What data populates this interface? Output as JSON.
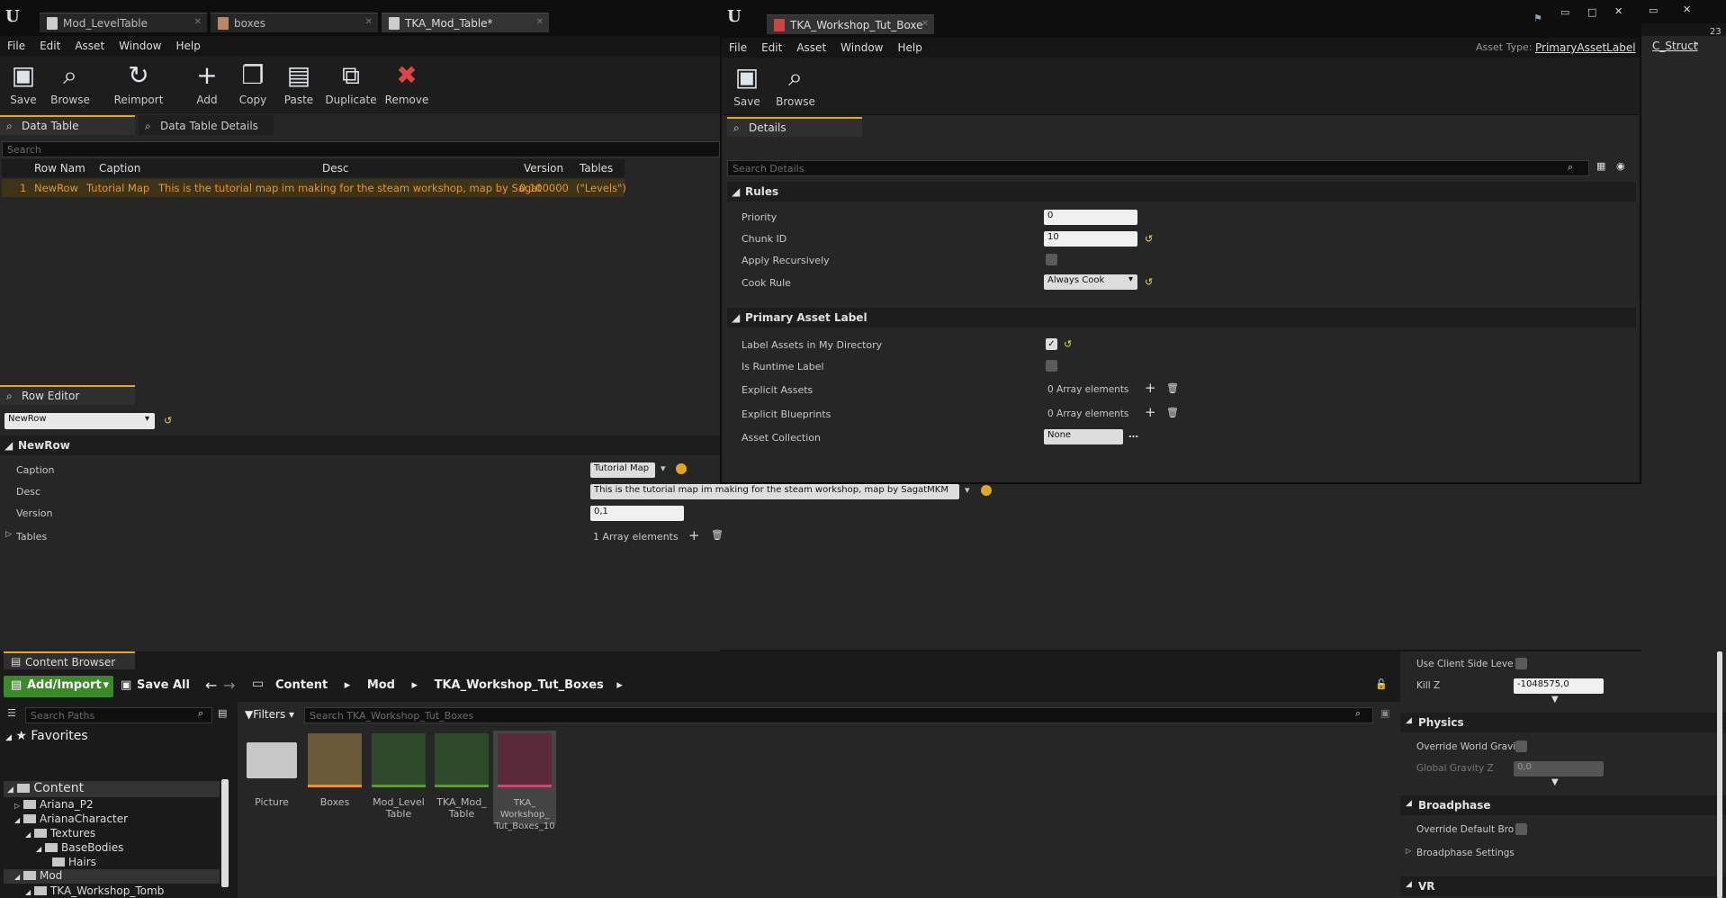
{
  "left_window": {
    "tabs": [
      {
        "label": "Mod_LevelTable"
      },
      {
        "label": "boxes"
      },
      {
        "label": "TKA_Mod_Table*"
      }
    ],
    "menu": [
      "File",
      "Edit",
      "Asset",
      "Window",
      "Help"
    ],
    "toolbar": [
      "Save",
      "Browse",
      "Reimport",
      "Add",
      "Copy",
      "Paste",
      "Duplicate",
      "Remove"
    ],
    "panel_tabs": {
      "data_table": "Data Table",
      "details": "Data Table Details"
    },
    "search_placeholder": "Search",
    "table": {
      "headers": [
        "Row Nam",
        "Caption",
        "Desc",
        "Version",
        "Tables"
      ],
      "rows": [
        [
          "1",
          "NewRow",
          "Tutorial Map",
          "This is the tutorial map im making for the steam workshop, map by Sagat",
          "0.100000",
          "(\"Levels\")"
        ]
      ]
    },
    "row_editor": {
      "tab": "Row Editor",
      "row_select": "NewRow",
      "section": "NewRow",
      "fields": {
        "caption_label": "Caption",
        "caption_value": "Tutorial Map",
        "desc_label": "Desc",
        "desc_value": "This is the tutorial map im making for the steam workshop, map by SagatMKM",
        "version_label": "Version",
        "version_value": "0,1",
        "tables_label": "Tables",
        "tables_value": "1 Array elements"
      }
    }
  },
  "right_window": {
    "tab": "TKA_Workshop_Tut_Boxe",
    "menu": [
      "File",
      "Edit",
      "Asset",
      "Window",
      "Help"
    ],
    "asset_type_label": "Asset Type:",
    "asset_type_value": "PrimaryAssetLabel",
    "toolbar": [
      "Save",
      "Browse"
    ],
    "details_tab": "Details",
    "search_placeholder": "Search Details",
    "rules": {
      "title": "Rules",
      "priority_label": "Priority",
      "priority_value": "0",
      "chunk_label": "Chunk ID",
      "chunk_value": "10",
      "apply_label": "Apply Recursively",
      "cook_label": "Cook Rule",
      "cook_value": "Always Cook"
    },
    "label_section": {
      "title": "Primary Asset Label",
      "label_assets": "Label Assets in My Directory",
      "runtime": "Is Runtime Label",
      "explicit_assets": "Explicit Assets",
      "explicit_assets_value": "0 Array elements",
      "explicit_bp": "Explicit Blueprints",
      "explicit_bp_value": "0 Array elements",
      "collection": "Asset Collection",
      "collection_value": "None"
    }
  },
  "partial_right": {
    "struct_text": "C_Struct",
    "num_text": "23",
    "use_client": "Use Client Side Leve",
    "killz_label": "Kill Z",
    "killz_value": "-1048575,0",
    "physics": "Physics",
    "override_gravity": "Override World Gravi",
    "global_gravity": "Global Gravity Z",
    "global_gravity_value": "0,0",
    "broadphase": "Broadphase",
    "override_broa": "Override Default Bro",
    "broadphase_settings": "Broadphase Settings",
    "vr": "VR"
  },
  "content_browser": {
    "tab": "Content Browser",
    "add_import": "Add/Import",
    "save_all": "Save All",
    "breadcrumb": [
      "Content",
      "Mod",
      "TKA_Workshop_Tut_Boxes"
    ],
    "search_paths": "Search Paths",
    "favorites": "Favorites",
    "filters": "Filters",
    "search_assets": "Search TKA_Workshop_Tut_Boxes",
    "tree": [
      "Content",
      "Ariana_P2",
      "ArianaCharacter",
      "Textures",
      "BaseBodies",
      "Hairs",
      "Mod",
      "TKA_Workshop_Tomb"
    ],
    "assets": [
      {
        "name": "Picture"
      },
      {
        "name": "Boxes"
      },
      {
        "name": "Mod_Level Table"
      },
      {
        "name": "TKA_Mod_ Table"
      },
      {
        "name": "TKA_ Workshop_ Tut_Boxes_10"
      }
    ]
  },
  "colors": {
    "accent": "#e0a820",
    "orange_text": "#e8962a",
    "green_button": "#3a8a2a"
  }
}
